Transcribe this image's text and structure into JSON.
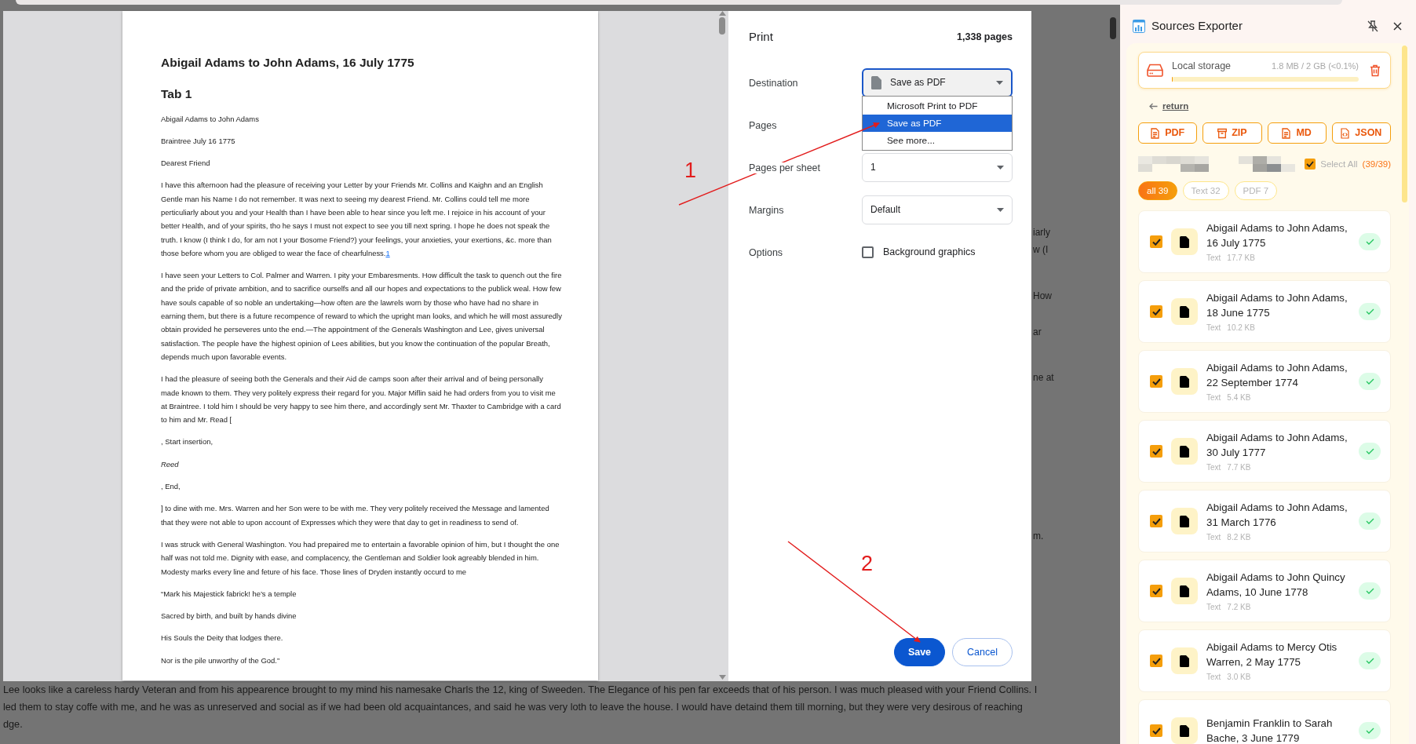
{
  "background_page": {
    "fragments": [
      "iarly",
      "w (I",
      "How",
      "ar",
      "ne at",
      "m."
    ],
    "lines": [
      " Lee looks like a careless hardy Veteran and from his appearence brought to my mind his namesake Charls the 12, king of Sweeden. The Elegance of his pen far exceeds that of his person. I was much pleased with your Friend Collins. I",
      "led them to stay coffe with me, and he was as unreserved and social as if we had been old acquaintances, and said he was very loth to leave the house. I would have detaind them till morning, but they were very desirous of reaching",
      "dge."
    ]
  },
  "print_dialog": {
    "preview": {
      "title": "Abigail Adams to John Adams, 16 July 1775",
      "heading": "Tab 1",
      "paragraphs": [
        {
          "kind": "plain",
          "text": "Abigail Adams to John Adams"
        },
        {
          "kind": "plain",
          "text": "Braintree July 16 1775"
        },
        {
          "kind": "plain",
          "text": "Dearest Friend"
        },
        {
          "kind": "plain",
          "text": "I have this afternoon had the pleasure of receiving your Letter by your Friends Mr. Collins and Kaighn and an English Gentle man his Name I do not remember. It was next to seeing my dearest Friend. Mr. Collins could tell me more perticuliarly about you and your Health than I have been able to hear since you left me. I rejoice in his account of your better Health, and of your spirits, tho he says I must not expect to see you till next spring. I hope he does not speak the truth. I know (I think I do, for am not I your Bosome Friend?) your feelings, your anxieties, your exertions, &c. more than those before whom you are obliged to wear the face of chearfulness.",
          "footnote": "1"
        },
        {
          "kind": "plain",
          "text": "I have seen your Letters to Col. Palmer and Warren. I pity your Embaresments. How difficult the task to quench out the fire and the pride of private ambition, and to sacrifice ourselfs and all our hopes and expectations to the publick weal. How few have souls capable of so noble an undertaking—how often are the lawrels worn by those who have had no share in earning them, but there is a future recompence of reward to which the upright man looks, and which he will most assuredly obtain provided he perseveres unto the end.—The appointment of the Generals Washington and Lee, gives universal satisfaction. The people have the highest opinion of Lees abilities, but you know the continuation of the popular Breath, depends much upon favorable events."
        },
        {
          "kind": "plain",
          "text": "I had the pleasure of seeing both the Generals and their Aid de camps soon after their arrival and of being personally made known to them. They very politely express their regard for you. Major Miflin said he had orders from you to visit me at Braintree. I told him I should be very happy to see him there, and accordingly sent Mr. Thaxter to Cambridge with a card to him and Mr. Read ["
        },
        {
          "kind": "plain",
          "text": ", Start insertion,"
        },
        {
          "kind": "italic",
          "text": "Reed"
        },
        {
          "kind": "plain",
          "text": ", End,"
        },
        {
          "kind": "plain",
          "text": "] to dine with me. Mrs. Warren and her Son were to be with me. They very politely received the Message and lamented that they were not able to upon account of Expresses which they were that day to get in readiness to send of."
        },
        {
          "kind": "plain",
          "text": "I was struck with General Washington. You had prepaired me to entertain a favorable opinion of him, but I thought the one half was not told me. Dignity with ease, and complacency, the Gentleman and Soldier look agreably blended in him. Modesty marks every line and feture of his face. Those lines of Dryden instantly occurd to me"
        },
        {
          "kind": "plain",
          "text": "“Mark his Majestick fabrick! he’s a temple"
        },
        {
          "kind": "plain",
          "text": "Sacred by birth, and built by hands divine"
        },
        {
          "kind": "plain",
          "text": "His Souls the Deity that lodges there."
        },
        {
          "kind": "plain",
          "text": "Nor is the pile unworthy of the God.”"
        }
      ]
    },
    "title": "Print",
    "page_count": "1,338 pages",
    "settings": [
      {
        "label": "Destination",
        "kind": "select",
        "value": "Save as PDF",
        "focused": true
      },
      {
        "label": "Pages",
        "kind": "covered"
      },
      {
        "label": "Pages per sheet",
        "kind": "select",
        "value": "1",
        "focused": false
      },
      {
        "label": "Margins",
        "kind": "select",
        "value": "Default",
        "focused": false
      },
      {
        "label": "Options",
        "kind": "checkbox",
        "text": "Background graphics",
        "checked": false
      }
    ],
    "dropdown": {
      "options": [
        {
          "label": "Microsoft Print to PDF",
          "selected": false
        },
        {
          "label": "Save as PDF",
          "selected": true
        },
        {
          "label": "See more...",
          "selected": false
        }
      ]
    },
    "buttons": [
      {
        "label": "Save",
        "kind": "primary"
      },
      {
        "label": "Cancel",
        "kind": "secondary"
      }
    ]
  },
  "annotations": [
    {
      "label": "1"
    },
    {
      "label": "2"
    }
  ],
  "sidebar": {
    "title": "Sources Exporter",
    "storage": {
      "label": "Local storage",
      "usage": "1.8 MB / 2 GB (<0.1%)",
      "level": 0.001
    },
    "back": "return",
    "export_buttons": [
      {
        "label": "PDF",
        "kind": "doc"
      },
      {
        "label": "ZIP",
        "kind": "archive"
      },
      {
        "label": "MD",
        "kind": "doc"
      },
      {
        "label": "JSON",
        "kind": "code"
      }
    ],
    "select_all": {
      "label": "Select All",
      "count": "(39/39)",
      "checked": true
    },
    "filters": [
      {
        "label": "all 39",
        "selected": true
      },
      {
        "label": "Text 32",
        "selected": false
      },
      {
        "label": "PDF 7",
        "selected": false
      }
    ],
    "items": [
      {
        "title": "Abigail Adams to John Adams, 16 July 1775",
        "type": "Text",
        "size": "17.7 KB",
        "checked": true,
        "done": true
      },
      {
        "title": "Abigail Adams to John Adams, 18 June 1775",
        "type": "Text",
        "size": "10.2 KB",
        "checked": true,
        "done": true
      },
      {
        "title": "Abigail Adams to John Adams, 22 September 1774",
        "type": "Text",
        "size": "5.4 KB",
        "checked": true,
        "done": true
      },
      {
        "title": "Abigail Adams to John Adams, 30 July 1777",
        "type": "Text",
        "size": "7.7 KB",
        "checked": true,
        "done": true
      },
      {
        "title": "Abigail Adams to John Adams, 31 March 1776",
        "type": "Text",
        "size": "8.2 KB",
        "checked": true,
        "done": true
      },
      {
        "title": "Abigail Adams to John Quincy Adams, 10 June 1778",
        "type": "Text",
        "size": "7.2 KB",
        "checked": true,
        "done": true
      },
      {
        "title": "Abigail Adams to Mercy Otis Warren, 2 May 1775",
        "type": "Text",
        "size": "3.0 KB",
        "checked": true,
        "done": true
      },
      {
        "title": "Benjamin Franklin to Sarah Bache, 3 June 1779",
        "checked": true,
        "done": true
      }
    ]
  }
}
